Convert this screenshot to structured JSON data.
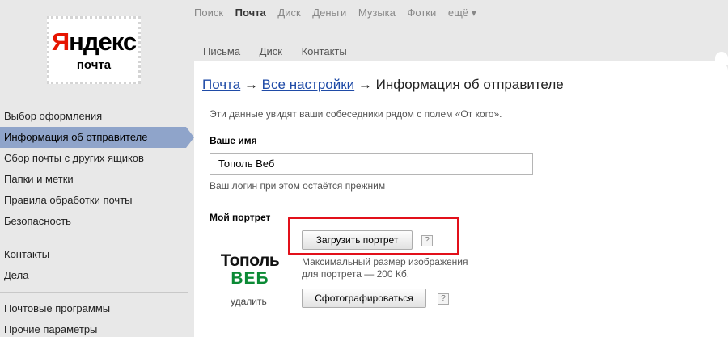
{
  "top_nav": {
    "items": [
      "Поиск",
      "Почта",
      "Диск",
      "Деньги",
      "Музыка",
      "Фотки"
    ],
    "more": "ещё ▾"
  },
  "logo": {
    "first_letter": "Я",
    "rest": "ндекс",
    "subtitle": "почта"
  },
  "sub_nav": {
    "items": [
      "Письма",
      "Диск",
      "Контакты"
    ]
  },
  "sidebar": {
    "group1": [
      "Выбор оформления",
      "Информация об отправителе",
      "Сбор почты с других ящиков",
      "Папки и метки",
      "Правила обработки почты",
      "Безопасность"
    ],
    "group2": [
      "Контакты",
      "Дела"
    ],
    "group3": [
      "Почтовые программы",
      "Прочие параметры"
    ]
  },
  "breadcrumb": {
    "link1": "Почта",
    "arrow1": " → ",
    "link2": "Все настройки",
    "arrow2": " → ",
    "current": "Информация об отправителе"
  },
  "form": {
    "intro": "Эти данные увидят ваши собеседники рядом с полем «От кого».",
    "name_label": "Ваше имя",
    "name_value": "Тополь Веб",
    "login_hint": "Ваш логин при этом остаётся прежним",
    "portrait_label": "Мой портрет",
    "upload_button": "Загрузить портрет",
    "help": "?",
    "max_size_line1": "Максимальный размер изображения",
    "max_size_line2": "для портрета — 200 Кб.",
    "photo_button": "Сфотографироваться",
    "avatar_line1": "Тополь",
    "avatar_line2": "ВЕБ",
    "delete": "удалить"
  },
  "colors": {
    "active_sidebar": "#8fa4ca",
    "link": "#1f4ba7",
    "highlight": "#e2101a",
    "logo_red": "#e61400",
    "avatar_green": "#0b8a35"
  }
}
